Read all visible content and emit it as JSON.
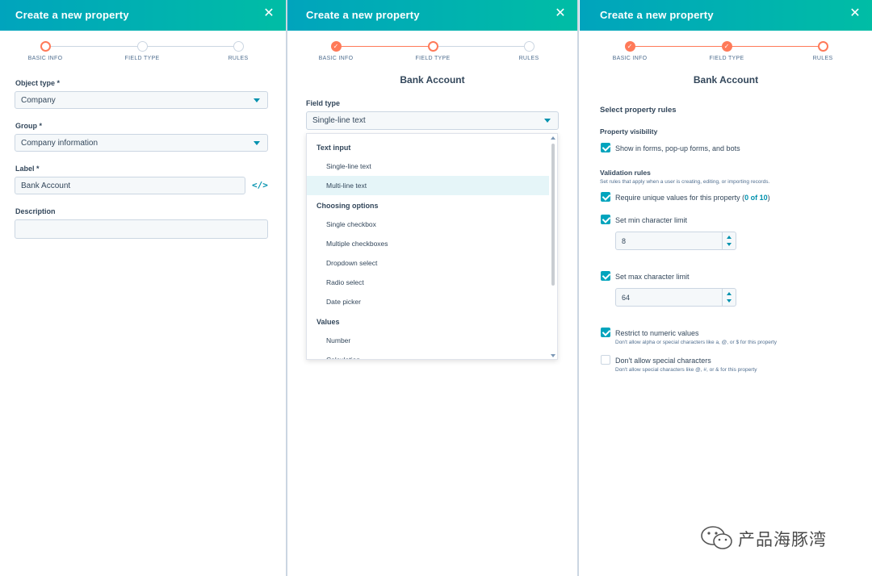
{
  "header_title": "Create a new property",
  "steps": [
    "BASIC INFO",
    "FIELD TYPE",
    "RULES"
  ],
  "panel1": {
    "object_type_label": "Object type *",
    "object_type_value": "Company",
    "group_label": "Group *",
    "group_value": "Company information",
    "label_label": "Label *",
    "label_value": "Bank Account",
    "description_label": "Description",
    "description_value": ""
  },
  "panel2": {
    "title": "Bank Account",
    "field_type_label": "Field type",
    "field_type_value": "Single-line text",
    "menu": {
      "group_text_input": "Text input",
      "opt_single_line": "Single-line text",
      "opt_multi_line": "Multi-line text",
      "group_choosing": "Choosing options",
      "opt_single_checkbox": "Single checkbox",
      "opt_multiple_checkboxes": "Multiple checkboxes",
      "opt_dropdown": "Dropdown select",
      "opt_radio": "Radio select",
      "opt_date": "Date picker",
      "group_values": "Values",
      "opt_number": "Number",
      "opt_calculation": "Calculation"
    }
  },
  "panel3": {
    "title": "Bank Account",
    "section_title": "Select property rules",
    "visibility_label": "Property visibility",
    "show_in_forms": "Show in forms, pop-up forms, and bots",
    "validation_label": "Validation rules",
    "validation_help": "Set rules that apply when a user is creating, editing, or importing records.",
    "require_unique_prefix": "Require unique values for this property (",
    "require_unique_count": "0 of 10",
    "require_unique_suffix": ")",
    "min_label": "Set min character limit",
    "min_value": "8",
    "max_label": "Set max character limit",
    "max_value": "64",
    "numeric_label": "Restrict to numeric values",
    "numeric_help": "Don't allow alpha or special characters like a, @, or $ for this property",
    "special_label": "Don't allow special characters",
    "special_help": "Don't allow special characters like @, #, or & for this property"
  },
  "watermark": "产品海豚湾",
  "colors": {
    "accent": "#00a4bd",
    "step": "#ff7a59",
    "link": "#0091ae"
  }
}
